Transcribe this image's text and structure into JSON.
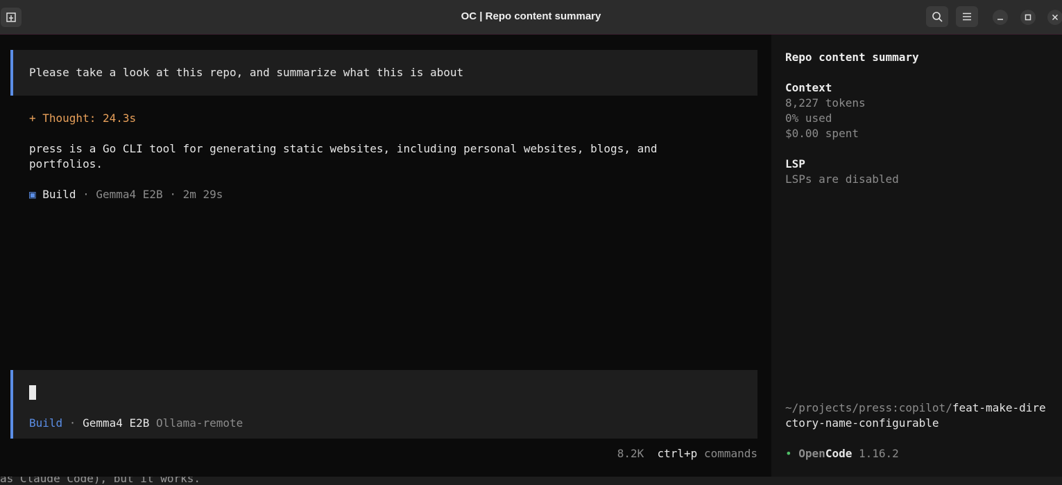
{
  "window": {
    "title": "OC | Repo content summary"
  },
  "chat": {
    "user_message": "Please take a look at this repo, and summarize what this is about",
    "thought": "+ Thought: 24.3s",
    "answer": "press is a Go CLI tool for generating static websites, including personal websites, blogs, and portfolios.",
    "run_meta": {
      "icon": "▣",
      "agent": "Build",
      "sep1": " · ",
      "model": "Gemma4 E2B",
      "sep2": " · ",
      "duration": "2m 29s"
    }
  },
  "input": {
    "agent": "Build",
    "sep": " · ",
    "model": "Gemma4 E2B",
    "provider": "Ollama-remote"
  },
  "footer": {
    "tokens": "8.2K",
    "shortcut": "ctrl+p",
    "shortcut_label": "commands"
  },
  "sidebar": {
    "title": "Repo content summary",
    "context_heading": "Context",
    "tokens": "8,227 tokens",
    "used": "0% used",
    "spent": "$0.00 spent",
    "lsp_heading": "LSP",
    "lsp_status": "LSPs are disabled",
    "path_prefix": "~/projects/press:copilot/",
    "branch": "feat-make-directory-name-configurable",
    "app_dot": "•",
    "app_name_a": "Open",
    "app_name_b": "Code",
    "version": "1.16.2"
  },
  "colors": {
    "accent_blue": "#5b8ee6",
    "thought_orange": "#e8a05a",
    "status_green": "#4fbf67"
  }
}
